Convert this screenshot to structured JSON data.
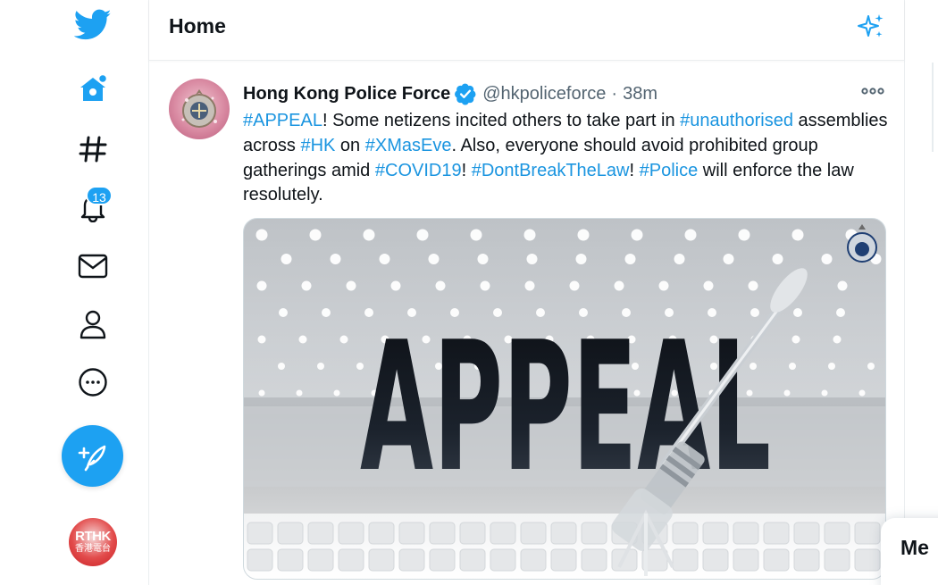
{
  "nav": {
    "badge_count": "13",
    "items": [
      "twitter-logo",
      "home",
      "explore",
      "notifications",
      "messages",
      "profile",
      "more"
    ],
    "account_label_top": "RTHK",
    "account_label_bottom": "香港電台"
  },
  "header": {
    "title": "Home"
  },
  "tweet": {
    "name": "Hong Kong Police Force",
    "handle": "@hkpoliceforce",
    "separator": "·",
    "time": "38m",
    "segments": [
      {
        "t": "#APPEAL",
        "ht": true
      },
      {
        "t": "! Some netizens incited others to take part in ",
        "ht": false
      },
      {
        "t": "#unauthorised",
        "ht": true
      },
      {
        "t": " assemblies across ",
        "ht": false
      },
      {
        "t": "#HK",
        "ht": true
      },
      {
        "t": " on ",
        "ht": false
      },
      {
        "t": "#XMasEve",
        "ht": true
      },
      {
        "t": ". Also, everyone should avoid prohibited group gatherings amid ",
        "ht": false
      },
      {
        "t": "#COVID19",
        "ht": true
      },
      {
        "t": "! ",
        "ht": false
      },
      {
        "t": "#DontBreakTheLaw",
        "ht": true
      },
      {
        "t": "! ",
        "ht": false
      },
      {
        "t": "#Police",
        "ht": true
      },
      {
        "t": " will enforce the law resolutely.",
        "ht": false
      }
    ],
    "media_text": "APPEAL"
  },
  "drawer": {
    "label": "Me"
  },
  "colors": {
    "brand": "#1da1f2",
    "hashtag": "#1b95e0",
    "muted": "#536471"
  }
}
